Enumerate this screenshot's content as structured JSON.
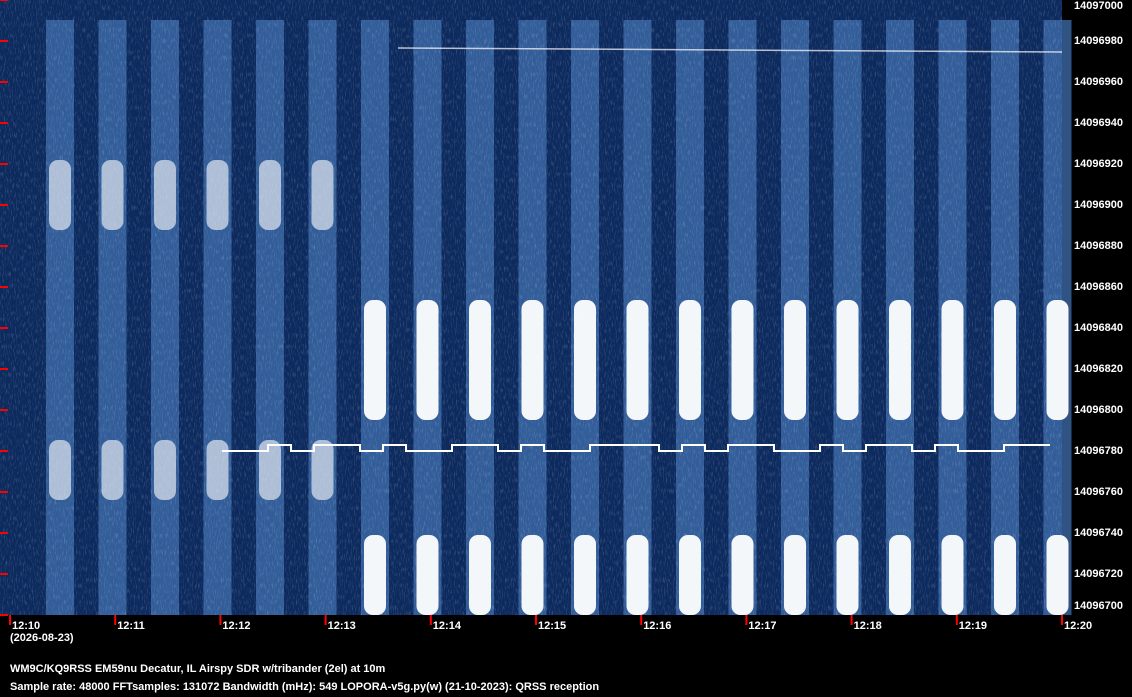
{
  "plot": {
    "type": "spectrogram-waterfall",
    "colormap": {
      "background": "#0d2a5e",
      "mid": "#3f6fae",
      "high": "#ffffff"
    },
    "tick_color": "#ff0000"
  },
  "y_axis": {
    "min": 14096700,
    "max": 14097000,
    "ticks": [
      "14097000",
      "14096980",
      "14096960",
      "14096940",
      "14096920",
      "14096900",
      "14096880",
      "14096860",
      "14096840",
      "14096820",
      "14096800",
      "14096780",
      "14096760",
      "14096740",
      "14096720",
      "14096700"
    ]
  },
  "x_axis": {
    "date": "(2026-08-23)",
    "ticks": [
      "12:10",
      "12:11",
      "12:12",
      "12:13",
      "12:14",
      "12:15",
      "12:16",
      "12:17",
      "12:18",
      "12:19",
      "12:20"
    ]
  },
  "info": {
    "station": "WM9C/KQ9RSS EM59nu Decatur, IL  Airspy SDR w/tribander (2el) at 10m",
    "params": "Sample rate: 48000    FFTsamples: 131072    Bandwidth (mHz): 549        LOPORA-v5g.py(w) (21-10-2023): QRSS reception"
  }
}
